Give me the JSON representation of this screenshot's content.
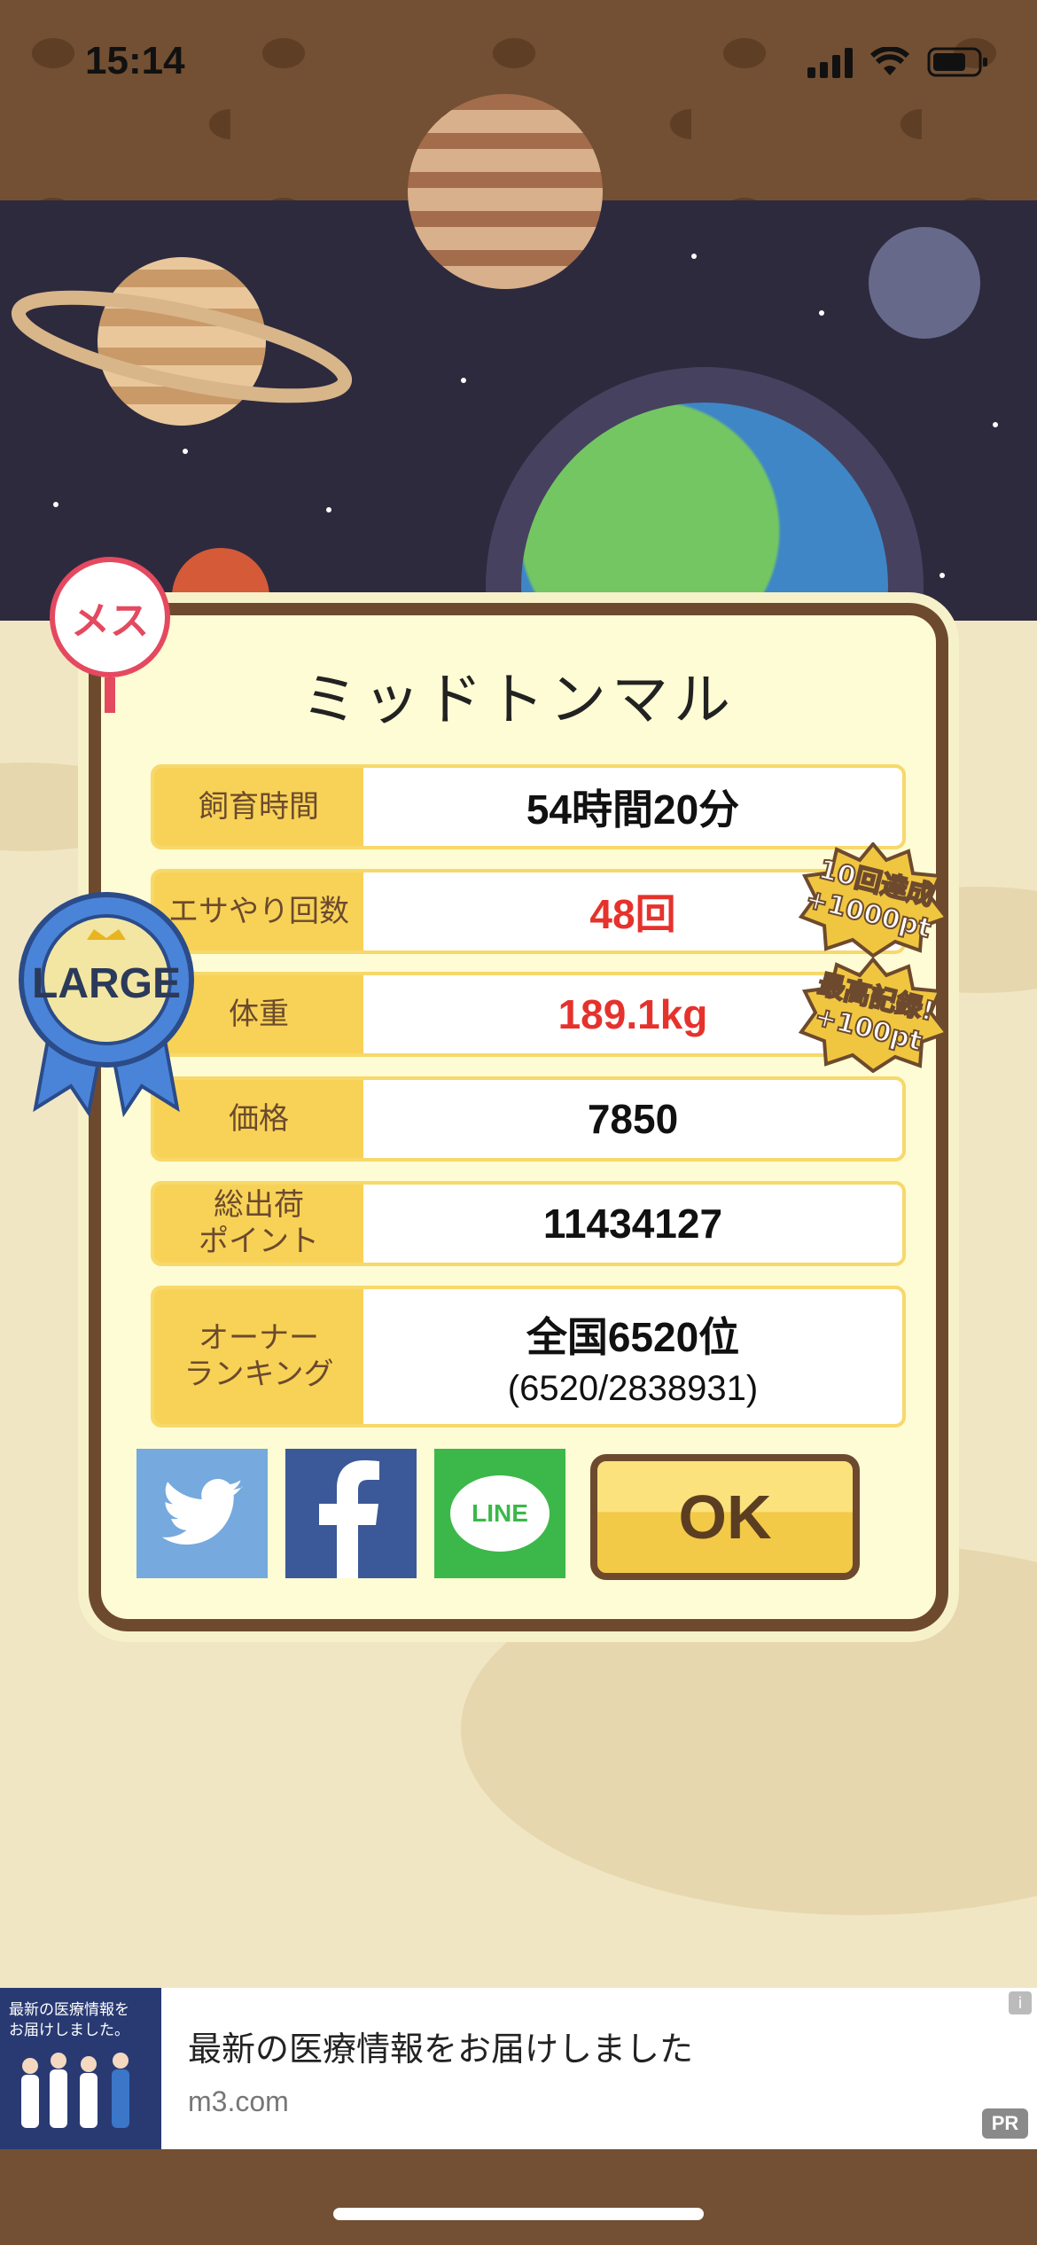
{
  "status_bar": {
    "time": "15:14"
  },
  "card": {
    "name": "ミッドトンマル",
    "rows": [
      {
        "label": "飼育時間",
        "value": "54時間20分",
        "highlight": false
      },
      {
        "label": "エサやり回数",
        "value": "48回",
        "highlight": true
      },
      {
        "label": "体重",
        "value": "189.1kg",
        "highlight": true
      },
      {
        "label": "価格",
        "value": "7850",
        "highlight": false
      },
      {
        "label": "総出荷\nポイント",
        "value": "11434127",
        "highlight": false
      },
      {
        "label": "オーナー\nランキング",
        "value": "全国6520位",
        "sub": "(6520/2838931)",
        "highlight": false
      }
    ],
    "ok_label": "OK",
    "gender_badge": "メス",
    "size_badge": "LARGE",
    "bonus1": {
      "line1": "10回達成",
      "line2": "+1000pt"
    },
    "bonus2": {
      "line1": "最高記録!",
      "line2": "+100pt"
    }
  },
  "share": {
    "twitter_icon": "twitter-icon",
    "facebook_icon": "facebook-icon",
    "line_label": "LINE"
  },
  "ad": {
    "thumb_text": "最新の医療情報を\nお届けしました。",
    "title": "最新の医療情報をお届けしました",
    "url": "m3.com",
    "pr_label": "PR",
    "info_label": "i"
  },
  "colors": {
    "accent_yellow": "#f8d256",
    "frame_brown": "#6d4a2e",
    "value_red": "#e6322c",
    "space": "#2d2a3e"
  }
}
